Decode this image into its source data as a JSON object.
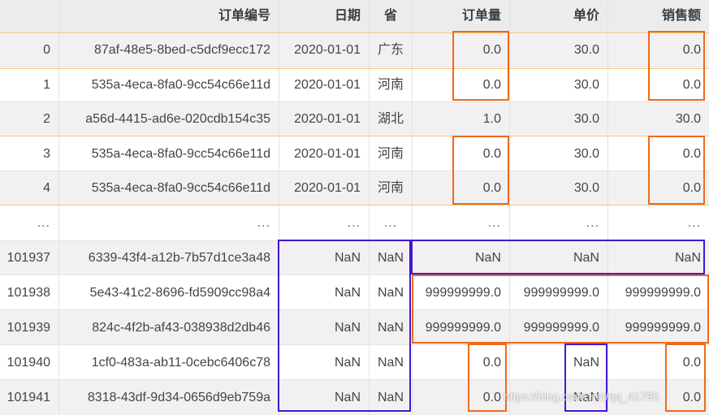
{
  "columns": [
    "",
    "订单编号",
    "日期",
    "省",
    "订单量",
    "单价",
    "销售额"
  ],
  "rows": [
    [
      "0",
      "87af-48e5-8bed-c5dcf9ecc172",
      "2020-01-01",
      "广东",
      "0.0",
      "30.0",
      "0.0"
    ],
    [
      "1",
      "535a-4eca-8fa0-9cc54c66e11d",
      "2020-01-01",
      "河南",
      "0.0",
      "30.0",
      "0.0"
    ],
    [
      "2",
      "a56d-4415-ad6e-020cdb154c35",
      "2020-01-01",
      "湖北",
      "1.0",
      "30.0",
      "30.0"
    ],
    [
      "3",
      "535a-4eca-8fa0-9cc54c66e11d",
      "2020-01-01",
      "河南",
      "0.0",
      "30.0",
      "0.0"
    ],
    [
      "4",
      "535a-4eca-8fa0-9cc54c66e11d",
      "2020-01-01",
      "河南",
      "0.0",
      "30.0",
      "0.0"
    ],
    [
      "...",
      "...",
      "...",
      "...",
      "...",
      "...",
      "..."
    ],
    [
      "101937",
      "6339-43f4-a12b-7b57d1ce3a48",
      "NaN",
      "NaN",
      "NaN",
      "NaN",
      "NaN"
    ],
    [
      "101938",
      "5e43-41c2-8696-fd5909cc98a4",
      "NaN",
      "NaN",
      "999999999.0",
      "999999999.0",
      "999999999.0"
    ],
    [
      "101939",
      "824c-4f2b-af43-038938d2db46",
      "NaN",
      "NaN",
      "999999999.0",
      "999999999.0",
      "999999999.0"
    ],
    [
      "101940",
      "1cf0-483a-ab11-0cebc6406c78",
      "NaN",
      "NaN",
      "0.0",
      "NaN",
      "0.0"
    ],
    [
      "101941",
      "8318-43df-9d34-0656d9eb759a",
      "NaN",
      "NaN",
      "0.0",
      "NaN",
      "0.0"
    ]
  ],
  "watermark": "https://blog.csdn.net/qq_41795",
  "colors": {
    "header_bg": "#ececec",
    "stripe_bg": "#f1f1f1",
    "orange_box": "#f06a1c",
    "purple_box": "#4417d6",
    "duplicate_band": "#f2c776"
  }
}
